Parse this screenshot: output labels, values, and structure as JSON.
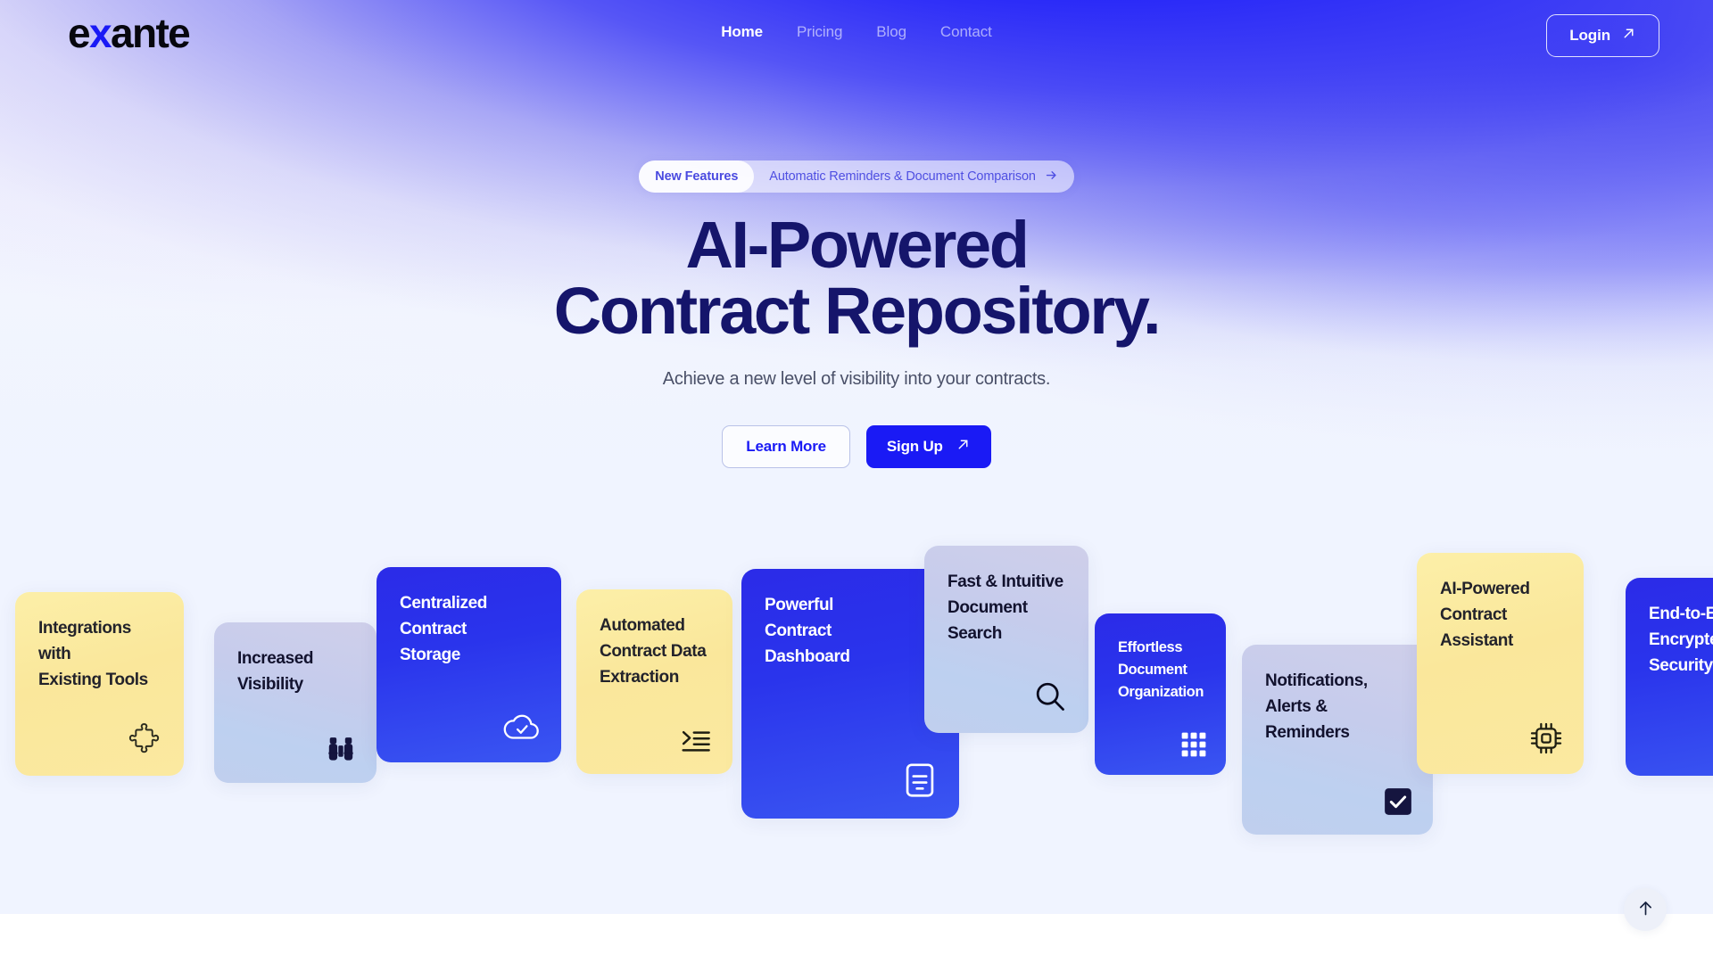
{
  "brand": {
    "name_part1": "e",
    "name_x": "x",
    "name_part2": "ante",
    "accent_color": "#1A1AF5"
  },
  "nav": {
    "links": [
      {
        "label": "Home",
        "active": true
      },
      {
        "label": "Pricing",
        "active": false
      },
      {
        "label": "Blog",
        "active": false
      },
      {
        "label": "Contact",
        "active": false
      }
    ],
    "login_label": "Login",
    "login_icon": "arrow-up-right-icon"
  },
  "hero": {
    "badge": {
      "tag": "New Features",
      "text": "Automatic Reminders & Document Comparison",
      "arrow_icon": "arrow-right-icon"
    },
    "headline_line1": "AI-Powered",
    "headline_line2": "Contract Repository.",
    "subheadline": "Achieve a new level of visibility into your contracts.",
    "cta_secondary": "Learn More",
    "cta_primary": "Sign Up",
    "cta_primary_icon": "arrow-up-right-icon",
    "headline_color": "#15156B",
    "background_blue": "#1A1AF5",
    "background_base": "#F0F4FF"
  },
  "cards": [
    {
      "title": "Integrations with\nExisting Tools",
      "theme": "yellow",
      "icon": "puzzle-piece-icon"
    },
    {
      "title": "Increased\nVisibility",
      "theme": "lav",
      "icon": "binoculars-icon"
    },
    {
      "title": "Centralized\nContract\nStorage",
      "theme": "blue",
      "icon": "cloud-check-icon"
    },
    {
      "title": "Automated\nContract Data\nExtraction",
      "theme": "yellow",
      "icon": "list-extract-icon"
    },
    {
      "title": "Powerful\nContract\nDashboard",
      "theme": "blue",
      "icon": "dashboard-document-icon"
    },
    {
      "title": "Fast & Intuitive\nDocument\nSearch",
      "theme": "lav",
      "icon": "magnifier-icon"
    },
    {
      "title": "Effortless\nDocument\nOrganization",
      "theme": "blue",
      "icon": "grid-icon"
    },
    {
      "title": "Notifications,\nAlerts & Reminders",
      "theme": "lav",
      "icon": "checkbox-checked-icon"
    },
    {
      "title": "AI-Powered\nContract\nAssistant",
      "theme": "yellow",
      "icon": "cpu-chip-icon"
    },
    {
      "title": "End-to-End\nEncrypted\nSecurity",
      "theme": "blue",
      "icon": "shield-lock-icon"
    }
  ],
  "scroll_top": {
    "icon": "arrow-up-icon"
  }
}
